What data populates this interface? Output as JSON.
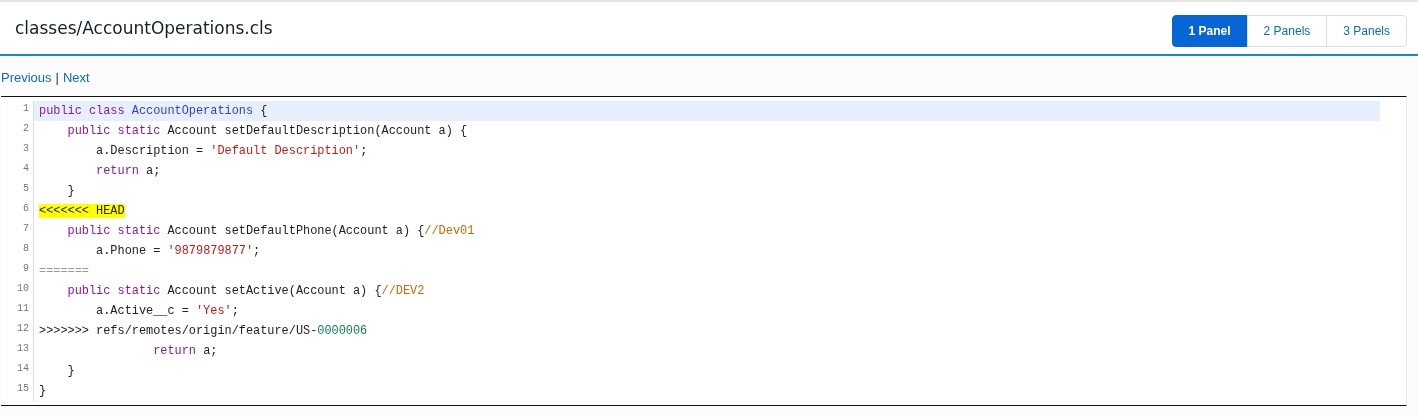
{
  "header": {
    "title": "classes/AccountOperations.cls"
  },
  "panel_buttons": [
    {
      "label": "1 Panel",
      "selected": true
    },
    {
      "label": "2 Panels",
      "selected": false
    },
    {
      "label": "3 Panels",
      "selected": false
    }
  ],
  "nav": {
    "previous": "Previous",
    "separator": "|",
    "next": "Next"
  },
  "code_lines": [
    {
      "number": "1",
      "selected": true,
      "tokens": [
        {
          "kind": "keyword",
          "text": "public class "
        },
        {
          "kind": "type",
          "text": "AccountOperations"
        },
        {
          "kind": "plain",
          "text": " {"
        }
      ]
    },
    {
      "number": "2",
      "selected": false,
      "tokens": [
        {
          "kind": "keyword",
          "text": "    public static "
        },
        {
          "kind": "plain",
          "text": "Account setDefaultDescription(Account a) {"
        }
      ]
    },
    {
      "number": "3",
      "selected": false,
      "tokens": [
        {
          "kind": "plain",
          "text": "        a.Description = "
        },
        {
          "kind": "string",
          "text": "'Default Description'"
        },
        {
          "kind": "plain",
          "text": ";"
        }
      ]
    },
    {
      "number": "4",
      "selected": false,
      "tokens": [
        {
          "kind": "keyword",
          "text": "        return "
        },
        {
          "kind": "plain",
          "text": "a;"
        }
      ]
    },
    {
      "number": "5",
      "selected": false,
      "tokens": [
        {
          "kind": "plain",
          "text": "    }"
        }
      ]
    },
    {
      "number": "6",
      "selected": false,
      "tokens": [
        {
          "kind": "marker",
          "text": "<<<<<<< HEAD"
        }
      ]
    },
    {
      "number": "7",
      "selected": false,
      "tokens": [
        {
          "kind": "keyword",
          "text": "    public static "
        },
        {
          "kind": "plain",
          "text": "Account setDefaultPhone(Account a) {"
        },
        {
          "kind": "comment",
          "text": "//Dev01"
        }
      ]
    },
    {
      "number": "8",
      "selected": false,
      "tokens": [
        {
          "kind": "plain",
          "text": "        a.Phone = "
        },
        {
          "kind": "string",
          "text": "'9879879877'"
        },
        {
          "kind": "plain",
          "text": ";"
        }
      ]
    },
    {
      "number": "9",
      "selected": false,
      "tokens": [
        {
          "kind": "separator",
          "text": "======="
        }
      ]
    },
    {
      "number": "10",
      "selected": false,
      "tokens": [
        {
          "kind": "keyword",
          "text": "    public static "
        },
        {
          "kind": "plain",
          "text": "Account setActive(Account a) {"
        },
        {
          "kind": "comment",
          "text": "//DEV2"
        }
      ]
    },
    {
      "number": "11",
      "selected": false,
      "tokens": [
        {
          "kind": "plain",
          "text": "        a.Active__c = "
        },
        {
          "kind": "string",
          "text": "'Yes'"
        },
        {
          "kind": "plain",
          "text": ";"
        }
      ]
    },
    {
      "number": "12",
      "selected": false,
      "tokens": [
        {
          "kind": "plain",
          "text": ">>>>>>> refs/remotes/origin/feature/US-"
        },
        {
          "kind": "number",
          "text": "0000006"
        }
      ]
    },
    {
      "number": "13",
      "selected": false,
      "tokens": [
        {
          "kind": "keyword",
          "text": "                return "
        },
        {
          "kind": "plain",
          "text": "a;"
        }
      ]
    },
    {
      "number": "14",
      "selected": false,
      "tokens": [
        {
          "kind": "plain",
          "text": "    }"
        }
      ]
    },
    {
      "number": "15",
      "selected": false,
      "tokens": [
        {
          "kind": "plain",
          "text": "}"
        }
      ]
    }
  ]
}
